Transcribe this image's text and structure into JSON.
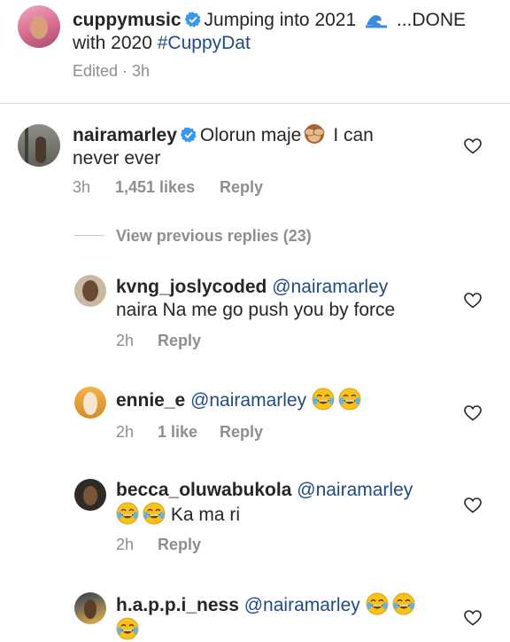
{
  "caption": {
    "username": "cuppymusic",
    "text_part1": "Jumping into 2021",
    "text_part2": "...DONE",
    "text_line2": "with 2020",
    "hashtag": "#CuppyDat",
    "meta": "Edited · 3h"
  },
  "comments": [
    {
      "username": "nairamarley",
      "text_a": "Olorun maje",
      "text_b": "I can",
      "text_line2": "never ever",
      "time": "3h",
      "likes": "1,451 likes",
      "reply": "Reply"
    },
    {
      "username": "kvng_joslycoded",
      "mention": "@nairamarley",
      "text_line2": "naira Na me go push you by force",
      "time": "2h",
      "reply": "Reply"
    },
    {
      "username": "ennie_e",
      "mention": "@nairamarley",
      "time": "2h",
      "likes": "1 like",
      "reply": "Reply"
    },
    {
      "username": "becca_oluwabukola",
      "mention": "@nairamarley",
      "text_line2": "Ka ma ri",
      "time": "2h",
      "reply": "Reply"
    },
    {
      "username": "h.a.p.p.i_ness",
      "mention": "@nairamarley"
    }
  ],
  "view_previous": "View previous replies (23)",
  "colors": {
    "verified_blue": "#3897f0",
    "mention_blue": "#1f4a8a",
    "meta_gray": "#8e8e8e"
  },
  "icons": [
    "verified-badge-icon",
    "wave-emoji",
    "see-no-evil-monkey-emoji",
    "tears-of-joy-emoji",
    "heart-outline-icon"
  ]
}
